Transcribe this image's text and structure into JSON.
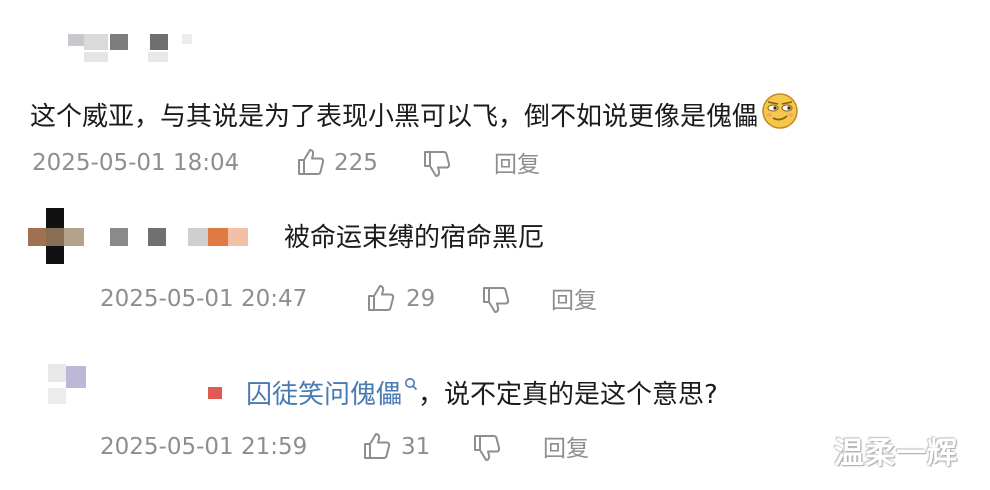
{
  "comments": [
    {
      "text": "这个威亚，与其说是为了表现小黑可以飞，倒不如说更像是傀儡",
      "emoji": "smirk-emoji",
      "timestamp": "2025-05-01 18:04",
      "likes": "225",
      "reply_label": "回复"
    },
    {
      "text": "被命运束缚的宿命黑厄",
      "timestamp": "2025-05-01 20:47",
      "likes": "29",
      "reply_label": "回复"
    },
    {
      "link_text": "囚徒笑问傀儡",
      "text": "，说不定真的是这个意思?",
      "timestamp": "2025-05-01 21:59",
      "likes": "31",
      "reply_label": "回复"
    }
  ],
  "watermark": "温柔一辉",
  "icons": [
    "thumbs-up-icon",
    "thumbs-down-icon",
    "search-icon",
    "flag-icon"
  ],
  "colors": {
    "link": "#4a7ab3",
    "meta": "#8e8e8e",
    "flag": "#e05a52"
  }
}
